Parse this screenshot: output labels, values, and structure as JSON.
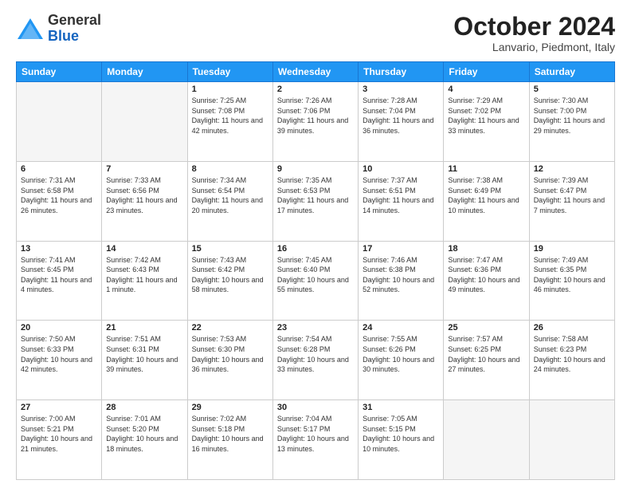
{
  "header": {
    "logo_general": "General",
    "logo_blue": "Blue",
    "month_title": "October 2024",
    "subtitle": "Lanvario, Piedmont, Italy"
  },
  "weekdays": [
    "Sunday",
    "Monday",
    "Tuesday",
    "Wednesday",
    "Thursday",
    "Friday",
    "Saturday"
  ],
  "weeks": [
    [
      {
        "day": "",
        "empty": true
      },
      {
        "day": "",
        "empty": true
      },
      {
        "day": "1",
        "sunrise": "7:25 AM",
        "sunset": "7:08 PM",
        "daylight": "11 hours and 42 minutes."
      },
      {
        "day": "2",
        "sunrise": "7:26 AM",
        "sunset": "7:06 PM",
        "daylight": "11 hours and 39 minutes."
      },
      {
        "day": "3",
        "sunrise": "7:28 AM",
        "sunset": "7:04 PM",
        "daylight": "11 hours and 36 minutes."
      },
      {
        "day": "4",
        "sunrise": "7:29 AM",
        "sunset": "7:02 PM",
        "daylight": "11 hours and 33 minutes."
      },
      {
        "day": "5",
        "sunrise": "7:30 AM",
        "sunset": "7:00 PM",
        "daylight": "11 hours and 29 minutes."
      }
    ],
    [
      {
        "day": "6",
        "sunrise": "7:31 AM",
        "sunset": "6:58 PM",
        "daylight": "11 hours and 26 minutes."
      },
      {
        "day": "7",
        "sunrise": "7:33 AM",
        "sunset": "6:56 PM",
        "daylight": "11 hours and 23 minutes."
      },
      {
        "day": "8",
        "sunrise": "7:34 AM",
        "sunset": "6:54 PM",
        "daylight": "11 hours and 20 minutes."
      },
      {
        "day": "9",
        "sunrise": "7:35 AM",
        "sunset": "6:53 PM",
        "daylight": "11 hours and 17 minutes."
      },
      {
        "day": "10",
        "sunrise": "7:37 AM",
        "sunset": "6:51 PM",
        "daylight": "11 hours and 14 minutes."
      },
      {
        "day": "11",
        "sunrise": "7:38 AM",
        "sunset": "6:49 PM",
        "daylight": "11 hours and 10 minutes."
      },
      {
        "day": "12",
        "sunrise": "7:39 AM",
        "sunset": "6:47 PM",
        "daylight": "11 hours and 7 minutes."
      }
    ],
    [
      {
        "day": "13",
        "sunrise": "7:41 AM",
        "sunset": "6:45 PM",
        "daylight": "11 hours and 4 minutes."
      },
      {
        "day": "14",
        "sunrise": "7:42 AM",
        "sunset": "6:43 PM",
        "daylight": "11 hours and 1 minute."
      },
      {
        "day": "15",
        "sunrise": "7:43 AM",
        "sunset": "6:42 PM",
        "daylight": "10 hours and 58 minutes."
      },
      {
        "day": "16",
        "sunrise": "7:45 AM",
        "sunset": "6:40 PM",
        "daylight": "10 hours and 55 minutes."
      },
      {
        "day": "17",
        "sunrise": "7:46 AM",
        "sunset": "6:38 PM",
        "daylight": "10 hours and 52 minutes."
      },
      {
        "day": "18",
        "sunrise": "7:47 AM",
        "sunset": "6:36 PM",
        "daylight": "10 hours and 49 minutes."
      },
      {
        "day": "19",
        "sunrise": "7:49 AM",
        "sunset": "6:35 PM",
        "daylight": "10 hours and 46 minutes."
      }
    ],
    [
      {
        "day": "20",
        "sunrise": "7:50 AM",
        "sunset": "6:33 PM",
        "daylight": "10 hours and 42 minutes."
      },
      {
        "day": "21",
        "sunrise": "7:51 AM",
        "sunset": "6:31 PM",
        "daylight": "10 hours and 39 minutes."
      },
      {
        "day": "22",
        "sunrise": "7:53 AM",
        "sunset": "6:30 PM",
        "daylight": "10 hours and 36 minutes."
      },
      {
        "day": "23",
        "sunrise": "7:54 AM",
        "sunset": "6:28 PM",
        "daylight": "10 hours and 33 minutes."
      },
      {
        "day": "24",
        "sunrise": "7:55 AM",
        "sunset": "6:26 PM",
        "daylight": "10 hours and 30 minutes."
      },
      {
        "day": "25",
        "sunrise": "7:57 AM",
        "sunset": "6:25 PM",
        "daylight": "10 hours and 27 minutes."
      },
      {
        "day": "26",
        "sunrise": "7:58 AM",
        "sunset": "6:23 PM",
        "daylight": "10 hours and 24 minutes."
      }
    ],
    [
      {
        "day": "27",
        "sunrise": "7:00 AM",
        "sunset": "5:21 PM",
        "daylight": "10 hours and 21 minutes."
      },
      {
        "day": "28",
        "sunrise": "7:01 AM",
        "sunset": "5:20 PM",
        "daylight": "10 hours and 18 minutes."
      },
      {
        "day": "29",
        "sunrise": "7:02 AM",
        "sunset": "5:18 PM",
        "daylight": "10 hours and 16 minutes."
      },
      {
        "day": "30",
        "sunrise": "7:04 AM",
        "sunset": "5:17 PM",
        "daylight": "10 hours and 13 minutes."
      },
      {
        "day": "31",
        "sunrise": "7:05 AM",
        "sunset": "5:15 PM",
        "daylight": "10 hours and 10 minutes."
      },
      {
        "day": "",
        "empty": true
      },
      {
        "day": "",
        "empty": true
      }
    ]
  ]
}
